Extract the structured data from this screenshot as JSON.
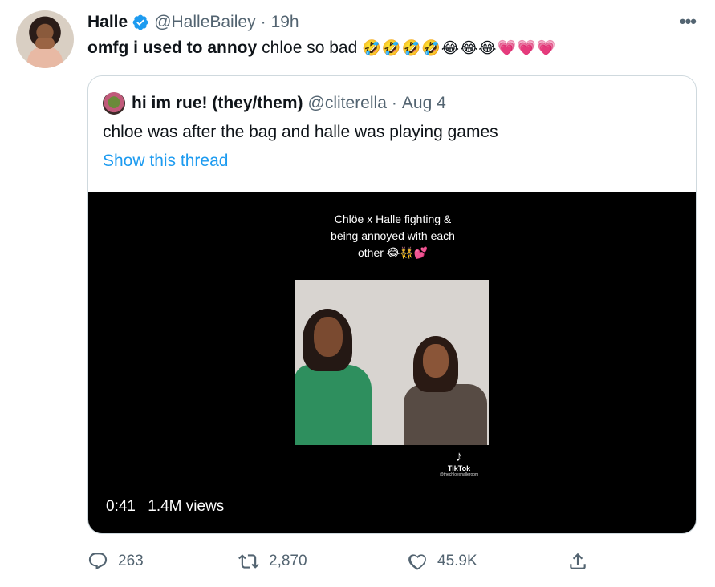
{
  "tweet": {
    "author_name": "Halle",
    "handle": "@HalleBailey",
    "time": "19h",
    "text_bold": "omfg i used to annoy",
    "text_plain": "chloe so bad",
    "emojis": "🤣🤣🤣🤣😂😂😂💗💗💗"
  },
  "quote": {
    "author_name": "hi im rue! (they/them)",
    "handle": "@cliterella",
    "time": "Aug 4",
    "text": "chloe was after the bag and halle was playing games",
    "show_thread": "Show this thread",
    "media": {
      "caption_line1": "Chlöe x Halle fighting &",
      "caption_line2": "being annoyed with each",
      "caption_line3": "other 😂👯💕",
      "tiktok_brand": "TikTok",
      "tiktok_account": "@thechloexhalleroom",
      "duration": "0:41",
      "views": "1.4M views"
    }
  },
  "actions": {
    "replies": "263",
    "retweets": "2,870",
    "likes": "45.9K"
  },
  "icons": {
    "verified": "verified-badge-icon",
    "more": "more-options-icon",
    "reply": "reply-icon",
    "retweet": "retweet-icon",
    "like": "heart-icon",
    "share": "share-icon",
    "tiktok": "tiktok-icon"
  },
  "colors": {
    "link": "#1d9bf0",
    "secondary_text": "#536471",
    "border": "#cfd9de"
  }
}
